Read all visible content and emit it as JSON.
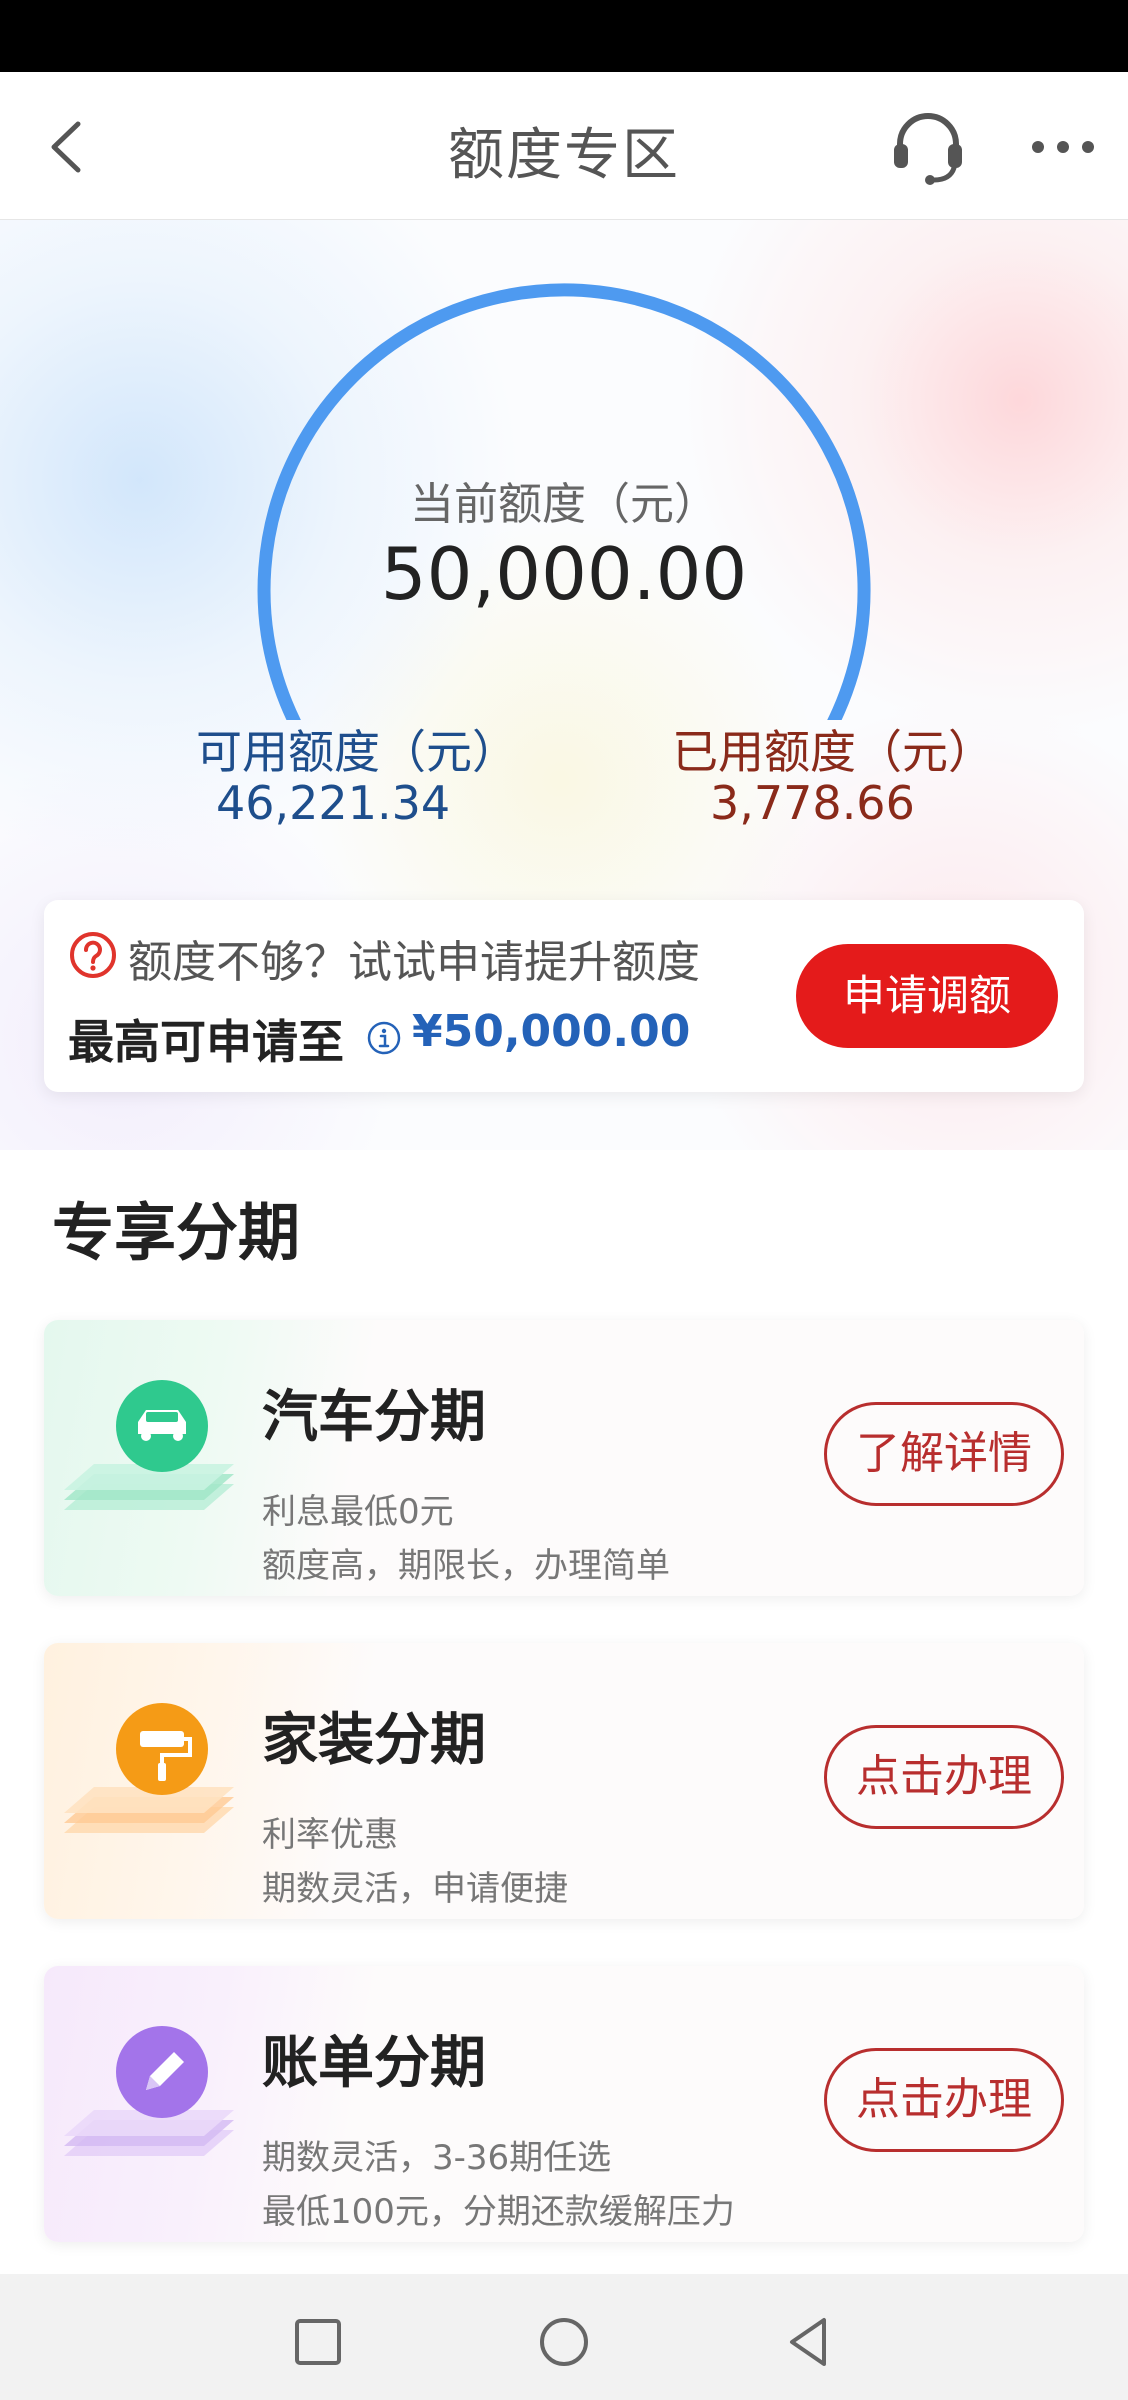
{
  "header": {
    "title": "额度专区",
    "back_icon": "chevron-left-icon",
    "service_icon": "headset-icon",
    "more_icon": "more-horizontal-icon"
  },
  "quota": {
    "current_label": "当前额度（元）",
    "current_value": "50,000.00",
    "available_label": "可用额度（元）",
    "available_value": "46,221.34",
    "used_label": "已用额度（元）",
    "used_value": "3,778.66",
    "used_fraction": 0.0756,
    "colors": {
      "available": "#4e9af0",
      "used": "#f25a1e"
    }
  },
  "promo": {
    "question": "额度不够？试试申请提升额度",
    "max_label": "最高可申请至",
    "max_value": "¥50,000.00",
    "apply_label": "申请调额"
  },
  "section": {
    "title": "专享分期"
  },
  "cards": [
    {
      "title": "汽车分期",
      "line1": "利息最低0元",
      "line2": "额度高，期限长，办理简单",
      "button": "了解详情",
      "icon": "car-icon",
      "accent": "#2fc98e"
    },
    {
      "title": "家装分期",
      "line1": "利率优惠",
      "line2": "期数灵活，申请便捷",
      "button": "点击办理",
      "icon": "paint-roller-icon",
      "accent": "#f59b16"
    },
    {
      "title": "账单分期",
      "line1": "期数灵活，3-36期任选",
      "line2": "最低100元，分期还款缓解压力",
      "button": "点击办理",
      "icon": "pencil-icon",
      "accent": "#a374ea"
    }
  ],
  "navbar": {
    "icons": [
      "square-icon",
      "circle-icon",
      "triangle-back-icon"
    ]
  }
}
